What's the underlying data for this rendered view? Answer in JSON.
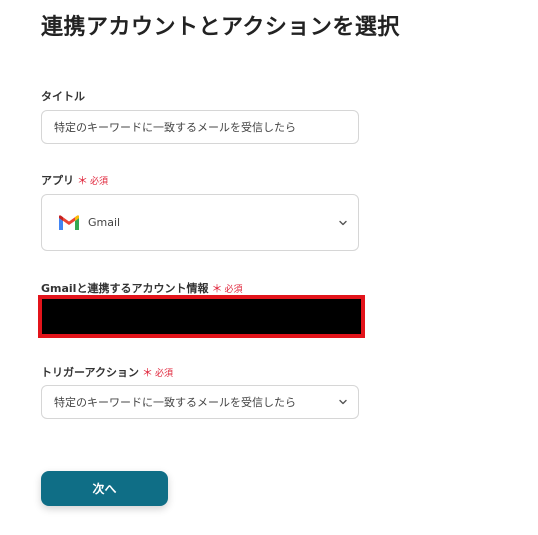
{
  "page": {
    "title": "連携アカウントとアクションを選択"
  },
  "form": {
    "title_field": {
      "label": "タイトル",
      "value": "特定のキーワードに一致するメールを受信したら"
    },
    "app_field": {
      "label": "アプリ",
      "required_mark": "＊",
      "required_text": "必須",
      "value": "Gmail",
      "icon": "gmail-icon",
      "dropdown_icon": "chevron-down-icon"
    },
    "account_field": {
      "label": "Gmailと連携するアカウント情報",
      "required_mark": "＊",
      "required_text": "必須"
    },
    "trigger_field": {
      "label": "トリガーアクション",
      "required_mark": "＊",
      "required_text": "必須",
      "value": "特定のキーワードに一致するメールを受信したら",
      "dropdown_icon": "chevron-down-icon"
    },
    "next_button": {
      "label": "次へ"
    }
  },
  "colors": {
    "primary_button": "#0f6e86",
    "required": "#e0243a",
    "redaction_border": "#e3141b"
  }
}
